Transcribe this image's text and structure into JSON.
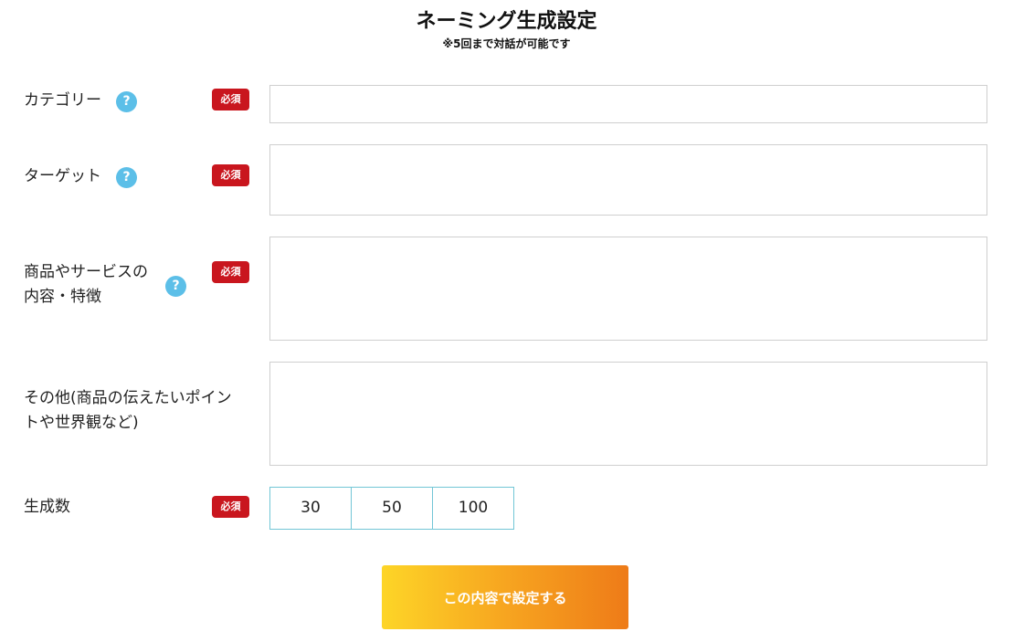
{
  "header": {
    "title": "ネーミング生成設定",
    "subtitle": "※5回まで対話が可能です"
  },
  "required_label": "必須",
  "help_glyph": "?",
  "fields": [
    {
      "label_lines": [
        "カテゴリー"
      ],
      "required": true,
      "help": true,
      "value": ""
    },
    {
      "label_lines": [
        "ターゲット"
      ],
      "required": true,
      "help": true,
      "value": ""
    },
    {
      "label_lines": [
        "商品やサービスの",
        "内容・特徴"
      ],
      "required": true,
      "help": true,
      "value": ""
    },
    {
      "label_lines": [
        "その他(商品の伝えたいポイン",
        "トや世界観など)"
      ],
      "required": false,
      "help": false,
      "value": ""
    }
  ],
  "count": {
    "label": "生成数",
    "required": true,
    "options": [
      "30",
      "50",
      "100"
    ]
  },
  "submit_label": "この内容で設定する",
  "colors": {
    "help_icon": "#5cbfe8",
    "required_badge": "#c9161e",
    "count_border": "#72c6d6",
    "button_gradient_start": "#fdd527",
    "button_gradient_end": "#ee7b18"
  }
}
